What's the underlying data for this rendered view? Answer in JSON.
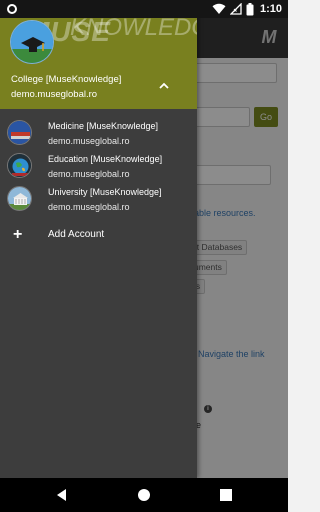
{
  "status_bar": {
    "time": "1:10"
  },
  "app": {
    "logo": "M",
    "go_button": "Go",
    "resources_text": "ilable resources.",
    "chips": [
      "ract Databases",
      "ocuments",
      "esis"
    ],
    "navigate_text": "Navigate the link",
    "e_text": "e",
    "colors": {
      "toolbar": "#3a3a3a",
      "accent": "#7c8a21"
    }
  },
  "drawer": {
    "header": {
      "watermark_line1": "MUSE",
      "watermark_line2": "KNOWLEDGE",
      "name": "College [MuseKnowledge]",
      "email": "demo.museglobal.ro",
      "background": "#79801f"
    },
    "accounts": [
      {
        "name": "Medicine [MuseKnowledge]",
        "email": "demo.museglobal.ro",
        "icon": "medicine-avatar-icon"
      },
      {
        "name": "Education [MuseKnowledge]",
        "email": "demo.museglobal.ro",
        "icon": "education-avatar-icon"
      },
      {
        "name": "University [MuseKnowledge]",
        "email": "demo.museglobal.ro",
        "icon": "university-avatar-icon"
      }
    ],
    "add_account": "Add Account"
  }
}
